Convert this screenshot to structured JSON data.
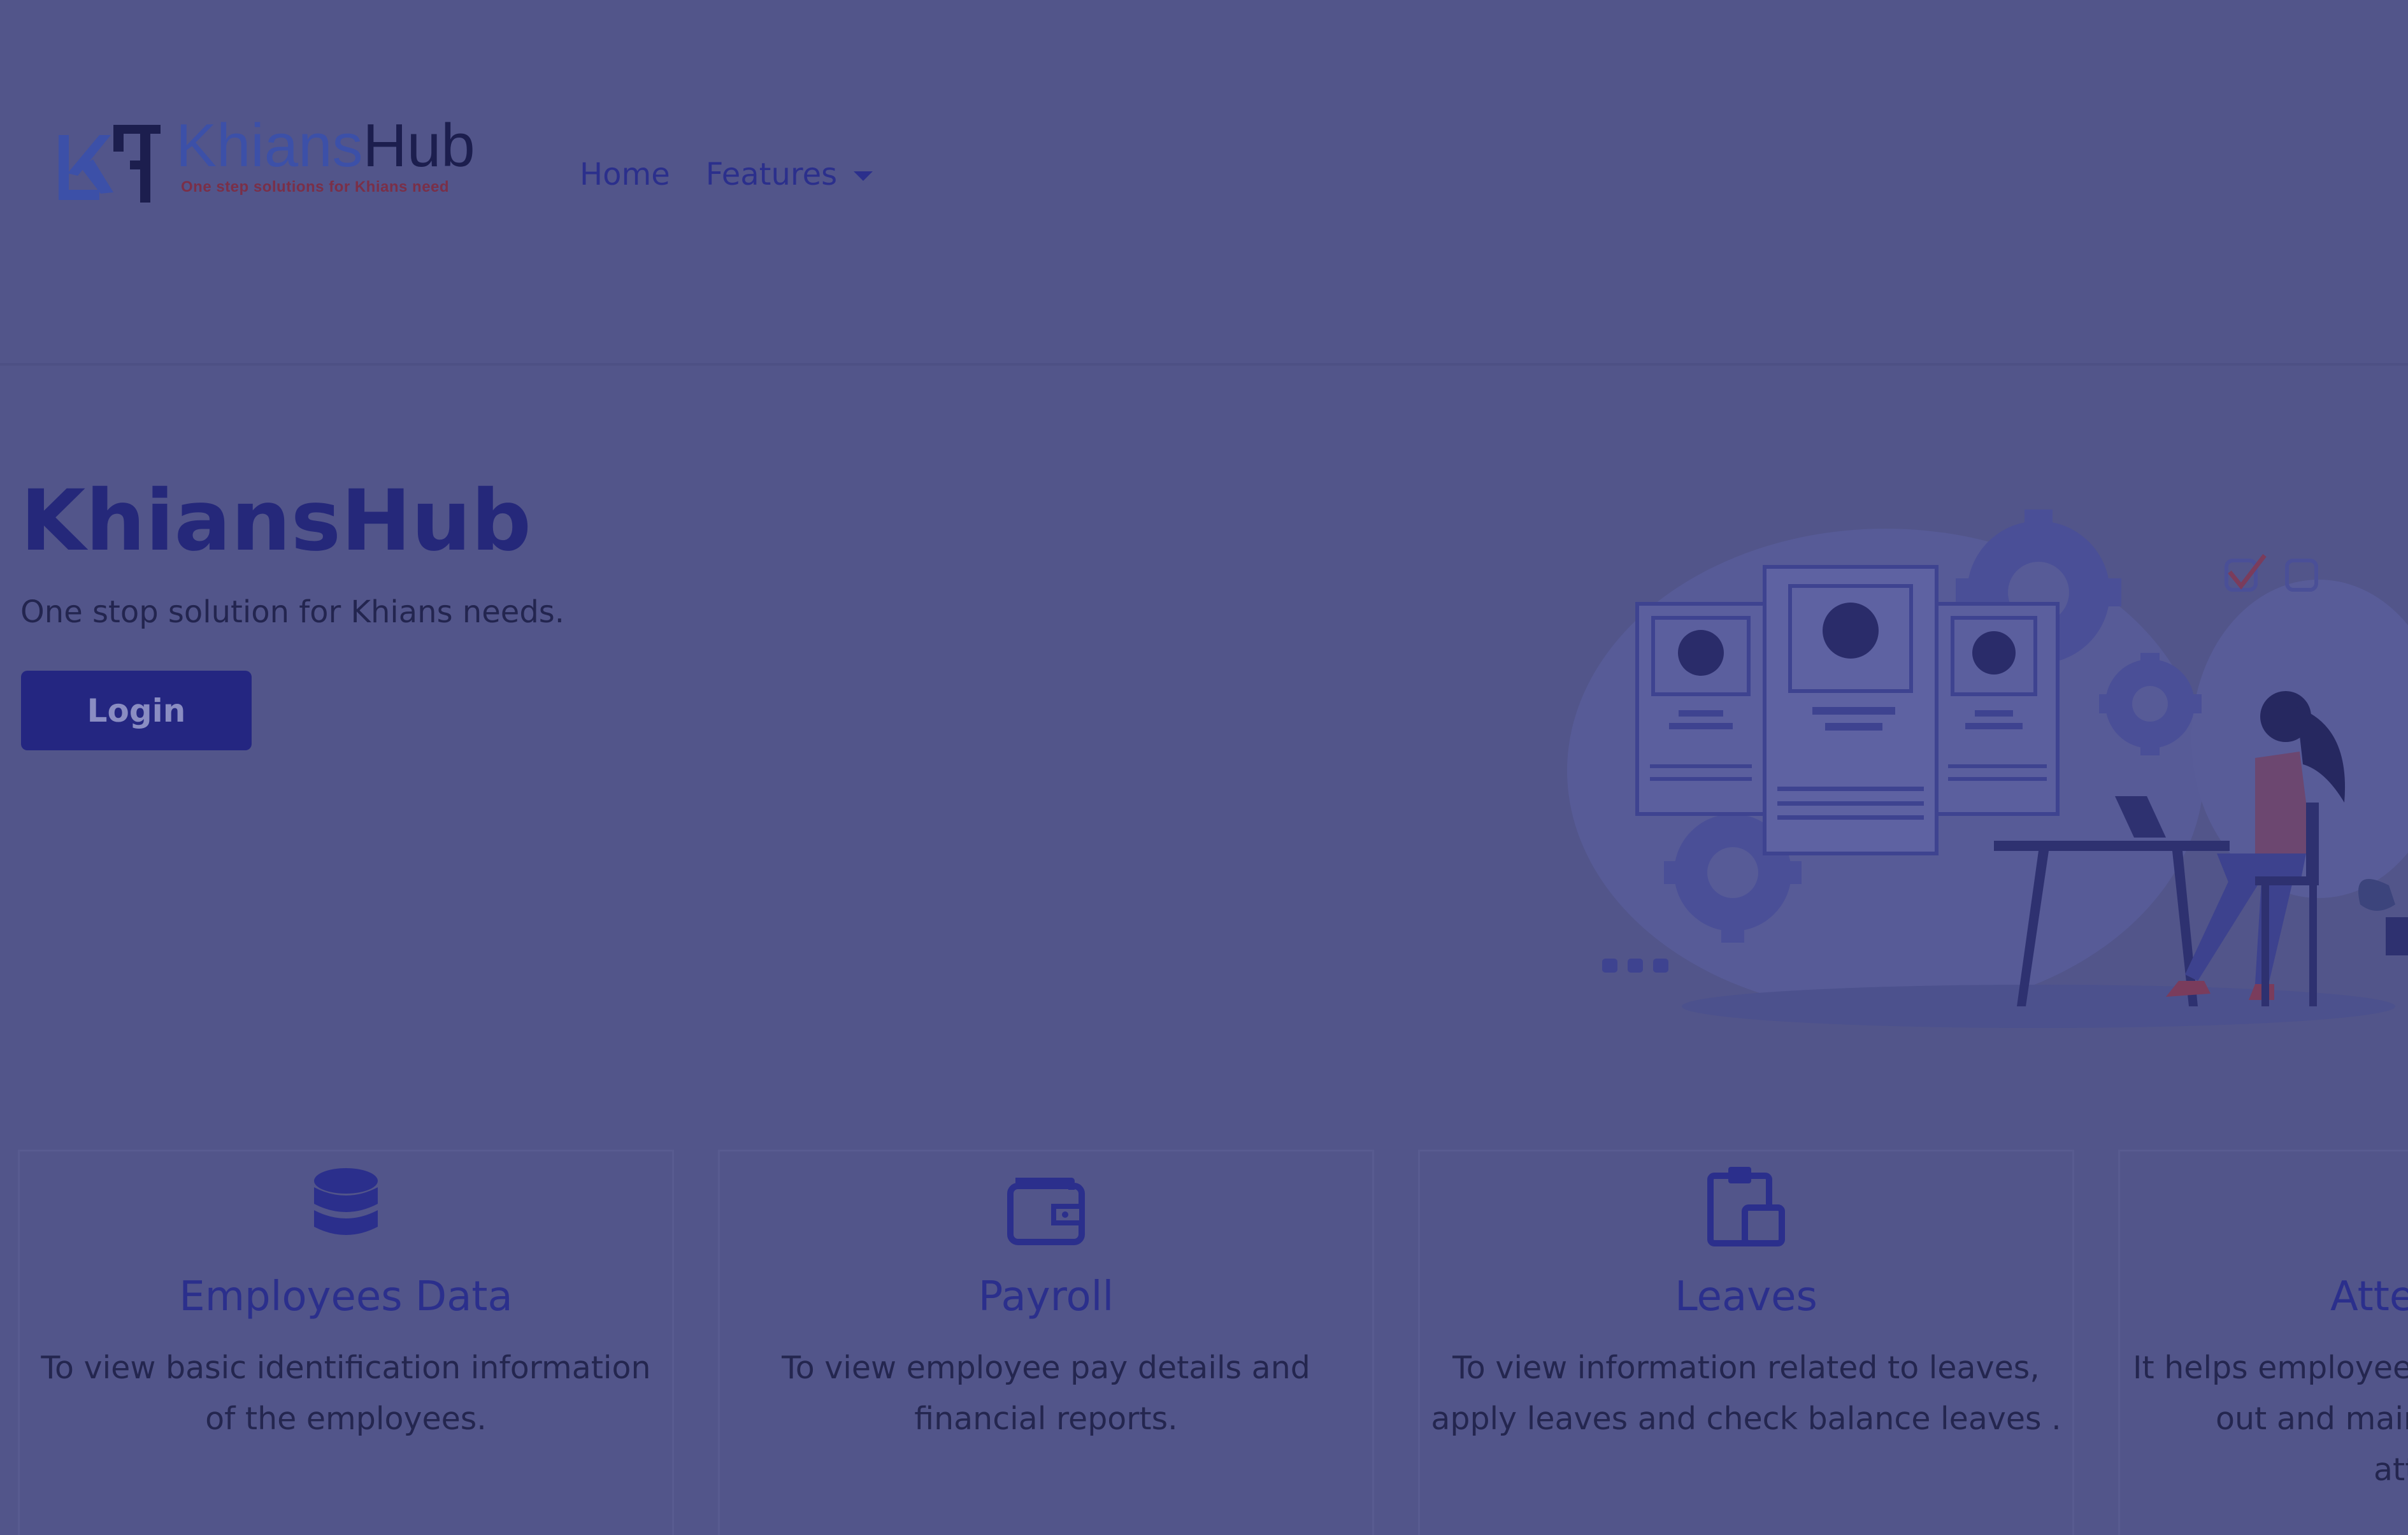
{
  "brand": {
    "word_part1": "Khians",
    "word_part2": "Hub",
    "tagline": "One step solutions for Khians need",
    "colors": {
      "blue": "#3c50a8",
      "dark": "#1c1e4e",
      "tagline": "#7a2f48"
    }
  },
  "nav": {
    "home": "Home",
    "features": "Features",
    "features_icon": "caret-down-icon"
  },
  "hero": {
    "title": "KhiansHub",
    "subtitle": "One stop solution for Khians needs.",
    "login_label": "Login",
    "illustration": "hr-profiles-illustration"
  },
  "cards": [
    {
      "icon": "database-icon",
      "title": "Employees Data",
      "desc": "To view basic identification information of the employees."
    },
    {
      "icon": "wallet-icon",
      "title": "Payroll",
      "desc": "To view employee pay details and financial reports."
    },
    {
      "icon": "clipboard-icon",
      "title": "Leaves",
      "desc": "To view information related to leaves, apply leaves and check balance leaves ."
    },
    {
      "icon": "attendance-icon",
      "title": "Atte",
      "desc": "It helps employees out and main atte"
    }
  ],
  "colors": {
    "background": "#52558a",
    "accent": "#2b2f8c",
    "button": "#242681"
  }
}
